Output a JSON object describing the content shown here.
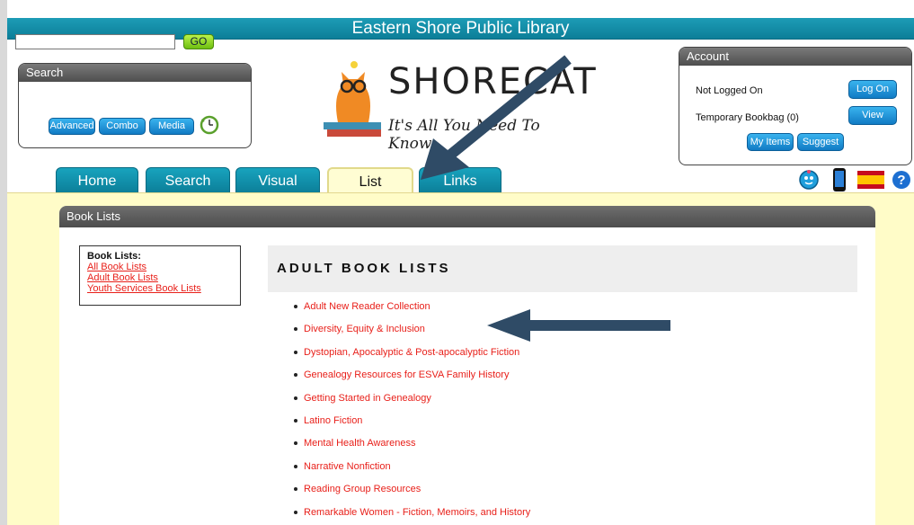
{
  "app_title": "Eastern Shore Public Library",
  "search": {
    "header": "Search",
    "input_value": "",
    "go_label": "GO",
    "advanced_label": "Advanced",
    "combo_label": "Combo",
    "media_label": "Media"
  },
  "logo": {
    "wordmark": "SHORECAT",
    "tagline": "It's All You Need To Know."
  },
  "account": {
    "header": "Account",
    "status": "Not Logged On",
    "bookbag": "Temporary Bookbag (0)",
    "log_on_label": "Log On",
    "view_label": "View",
    "my_items_label": "My Items",
    "suggest_label": "Suggest"
  },
  "tabs": [
    {
      "label": "Home"
    },
    {
      "label": "Search"
    },
    {
      "label": "Visual"
    },
    {
      "label": "List"
    },
    {
      "label": "Links"
    }
  ],
  "panel": {
    "header": "Book Lists",
    "side_title": "Book Lists:",
    "side_links": [
      "All Book Lists",
      "Adult Book Lists",
      "Youth Services Book Lists"
    ],
    "main_title": "ADULT BOOK LISTS",
    "items": [
      "Adult New Reader Collection",
      "Diversity, Equity & Inclusion",
      "Dystopian, Apocalyptic & Post-apocalyptic Fiction",
      "Genealogy Resources for ESVA Family History",
      "Getting Started in Genealogy",
      "Latino Fiction",
      "Mental Health Awareness",
      "Narrative Nonfiction",
      "Reading Group Resources",
      "Remarkable Women - Fiction, Memoirs, and History"
    ]
  },
  "colors": {
    "teal": "#0c7f99",
    "link_red": "#e8201a",
    "content_bg": "#fffcc8",
    "arrow": "#2f4b66"
  },
  "icons": [
    "clock-icon",
    "kids-icon",
    "mobile-icon",
    "spanish-flag-icon",
    "help-icon",
    "arrow-icon"
  ]
}
